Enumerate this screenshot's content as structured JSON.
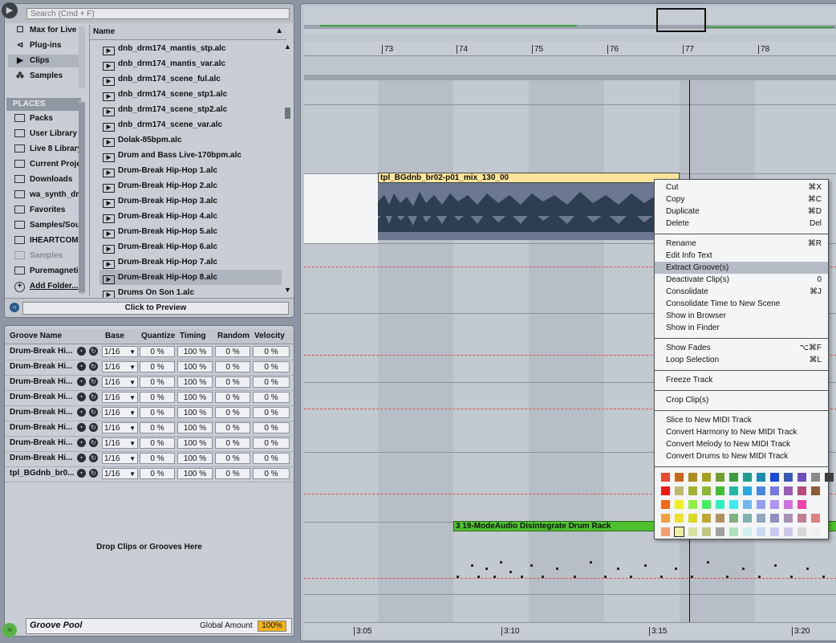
{
  "search": {
    "placeholder": "Search (Cmd + F)"
  },
  "categories": [
    {
      "label": "Max for Live",
      "icon": "max-icon"
    },
    {
      "label": "Plug-ins",
      "icon": "plugin-icon"
    },
    {
      "label": "Clips",
      "icon": "clip-icon"
    },
    {
      "label": "Samples",
      "icon": "waveform-icon"
    }
  ],
  "places_header": "PLACES",
  "places": [
    "Packs",
    "User Library",
    "Live 8 Library",
    "Current Project",
    "Downloads",
    "wa_synth_drums",
    "Favorites",
    "Samples/Sounds",
    "IHEARTCOMP",
    "Samples",
    "Puremagnetik"
  ],
  "add_folder": "Add Folder...",
  "browser": {
    "column": "Name",
    "files": [
      "dnb_drm174_mantis_stp.alc",
      "dnb_drm174_mantis_var.alc",
      "dnb_drm174_scene_ful.alc",
      "dnb_drm174_scene_stp1.alc",
      "dnb_drm174_scene_stp2.alc",
      "dnb_drm174_scene_var.alc",
      "Dolak-85bpm.alc",
      "Drum and Bass Live-170bpm.alc",
      "Drum-Break Hip-Hop 1.alc",
      "Drum-Break Hip-Hop 2.alc",
      "Drum-Break Hip-Hop 3.alc",
      "Drum-Break Hip-Hop 4.alc",
      "Drum-Break Hip-Hop 5.alc",
      "Drum-Break Hip-Hop 6.alc",
      "Drum-Break Hip-Hop 7.alc",
      "Drum-Break Hip-Hop 8.alc",
      "Drums On Son 1.alc"
    ]
  },
  "preview": "Click to Preview",
  "groove": {
    "headers": [
      "Groove Name",
      "Base",
      "Quantize",
      "Timing",
      "Random",
      "Velocity"
    ],
    "rows": [
      {
        "name": "Drum-Break Hi...",
        "base": "1/16",
        "quantize": "0 %",
        "timing": "100 %",
        "random": "0 %",
        "velocity": "0 %"
      },
      {
        "name": "Drum-Break Hi...",
        "base": "1/16",
        "quantize": "0 %",
        "timing": "100 %",
        "random": "0 %",
        "velocity": "0 %"
      },
      {
        "name": "Drum-Break Hi...",
        "base": "1/16",
        "quantize": "0 %",
        "timing": "100 %",
        "random": "0 %",
        "velocity": "0 %"
      },
      {
        "name": "Drum-Break Hi...",
        "base": "1/16",
        "quantize": "0 %",
        "timing": "100 %",
        "random": "0 %",
        "velocity": "0 %"
      },
      {
        "name": "Drum-Break Hi...",
        "base": "1/16",
        "quantize": "0 %",
        "timing": "100 %",
        "random": "0 %",
        "velocity": "0 %"
      },
      {
        "name": "Drum-Break Hi...",
        "base": "1/16",
        "quantize": "0 %",
        "timing": "100 %",
        "random": "0 %",
        "velocity": "0 %"
      },
      {
        "name": "Drum-Break Hi...",
        "base": "1/16",
        "quantize": "0 %",
        "timing": "100 %",
        "random": "0 %",
        "velocity": "0 %"
      },
      {
        "name": "Drum-Break Hi...",
        "base": "1/16",
        "quantize": "0 %",
        "timing": "100 %",
        "random": "0 %",
        "velocity": "0 %"
      },
      {
        "name": "tpl_BGdnb_br0...",
        "base": "1/16",
        "quantize": "0 %",
        "timing": "100 %",
        "random": "0 %",
        "velocity": "0 %"
      }
    ],
    "drop_text": "Drop Clips or Grooves Here",
    "title": "Groove Pool",
    "global_amount_label": "Global Amount",
    "global_amount": "100%"
  },
  "ruler": {
    "bars": [
      "73",
      "74",
      "75",
      "76",
      "77",
      "78"
    ]
  },
  "time_ruler": [
    "3:05",
    "3:10",
    "3:15",
    "3:20"
  ],
  "clips": {
    "audio": "tpl_BGdnb_br02-p01_mix_130_00",
    "midi": "3 19-ModeAudio Disintegrate Drum Rack"
  },
  "context_menu": {
    "groups": [
      [
        {
          "label": "Cut",
          "shortcut": "⌘X"
        },
        {
          "label": "Copy",
          "shortcut": "⌘C"
        },
        {
          "label": "Duplicate",
          "shortcut": "⌘D"
        },
        {
          "label": "Delete",
          "shortcut": "Del"
        }
      ],
      [
        {
          "label": "Rename",
          "shortcut": "⌘R"
        },
        {
          "label": "Edit Info Text",
          "shortcut": ""
        },
        {
          "label": "Extract Groove(s)",
          "shortcut": "",
          "highlight": true
        },
        {
          "label": "Deactivate Clip(s)",
          "shortcut": "0"
        },
        {
          "label": "Consolidate",
          "shortcut": "⌘J"
        },
        {
          "label": "Consolidate Time to New Scene",
          "shortcut": ""
        },
        {
          "label": "Show in Browser",
          "shortcut": ""
        },
        {
          "label": "Show in Finder",
          "shortcut": ""
        }
      ],
      [
        {
          "label": "Show Fades",
          "shortcut": "⌥⌘F"
        },
        {
          "label": "Loop Selection",
          "shortcut": "⌘L"
        }
      ],
      [
        {
          "label": "Freeze Track",
          "shortcut": ""
        }
      ],
      [
        {
          "label": "Crop Clip(s)",
          "shortcut": ""
        }
      ],
      [
        {
          "label": "Slice to New MIDI Track",
          "shortcut": ""
        },
        {
          "label": "Convert Harmony to New MIDI Track",
          "shortcut": ""
        },
        {
          "label": "Convert Melody to New MIDI Track",
          "shortcut": ""
        },
        {
          "label": "Convert Drums to New MIDI Track",
          "shortcut": ""
        }
      ]
    ],
    "colors": [
      [
        "#e8492f",
        "#c8651c",
        "#b08c1c",
        "#a6a01a",
        "#6ea030",
        "#3d9c3e",
        "#1f9c8c",
        "#1b8ab0",
        "#1a4ad8",
        "#3a5ab8",
        "#6a50b8",
        "#8a8a8a",
        "#3e3e3e"
      ],
      [
        "#f01818",
        "#c0b870",
        "#a6b030",
        "#8cb830",
        "#40c030",
        "#20b8a0",
        "#28a8e0",
        "#4888e0",
        "#7878e0",
        "#9a5ab8",
        "#b84a7a",
        "#8a5a3a"
      ],
      [
        "#f06818",
        "#f0f020",
        "#90f040",
        "#40f060",
        "#30f0c0",
        "#40e8f0",
        "#70b8f0",
        "#90a0f0",
        "#b090f0",
        "#d070e0",
        "#f040b0"
      ],
      [
        "#f0a040",
        "#f0e030",
        "#d8d820",
        "#c0a830",
        "#b09060",
        "#80b080",
        "#80b0b0",
        "#90a8c0",
        "#9090c0",
        "#a890b8",
        "#c08090",
        "#e08080"
      ],
      [
        "#f0a070",
        "#f0f0a0",
        "#d8e0a0",
        "#c0c880",
        "#a0a0a0",
        "#b0e0c0",
        "#d0f0f0",
        "#c8d8f0",
        "#c8c8f0",
        "#d0c8e8",
        "#d8d8d8",
        "#f0f0f0"
      ]
    ]
  }
}
